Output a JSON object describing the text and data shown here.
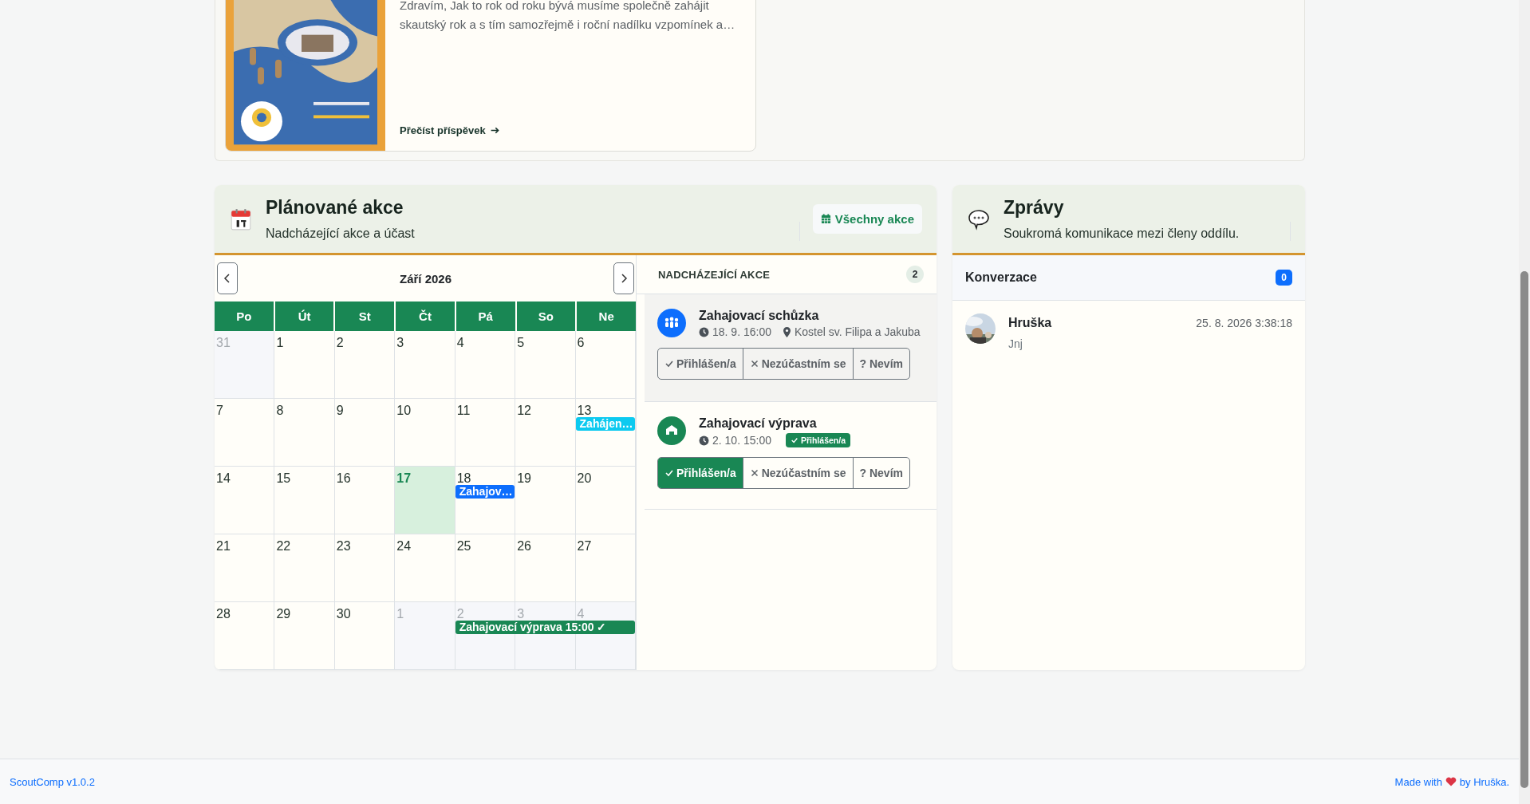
{
  "post": {
    "excerpt": "Zdravím, Jak to rok od roku bývá musíme společně zahájit skautský rok a s tím samozřejmě i roční nadílku vzpomínek a…",
    "link": "Přečíst příspěvek"
  },
  "events_panel": {
    "title": "Plánované akce",
    "subtitle": "Nadcházející akce a účast",
    "all_button": "Všechny akce",
    "calendar": {
      "month": "Září 2026",
      "weekdays": [
        "Po",
        "Út",
        "St",
        "Čt",
        "Pá",
        "So",
        "Ne"
      ],
      "weeks": [
        {
          "days": [
            {
              "label": "31",
              "outside": true,
              "today": false
            },
            {
              "label": "1",
              "outside": false,
              "today": false
            },
            {
              "label": "2",
              "outside": false,
              "today": false
            },
            {
              "label": "3",
              "outside": false,
              "today": false
            },
            {
              "label": "4",
              "outside": false,
              "today": false
            },
            {
              "label": "5",
              "outside": false,
              "today": false
            },
            {
              "label": "6",
              "outside": false,
              "today": false
            }
          ]
        },
        {
          "days": [
            {
              "label": "7",
              "outside": false,
              "today": false
            },
            {
              "label": "8",
              "outside": false,
              "today": false
            },
            {
              "label": "9",
              "outside": false,
              "today": false
            },
            {
              "label": "10",
              "outside": false,
              "today": false
            },
            {
              "label": "11",
              "outside": false,
              "today": false
            },
            {
              "label": "12",
              "outside": false,
              "today": false
            },
            {
              "label": "13",
              "outside": false,
              "today": false,
              "event": {
                "title": "Zahájen…",
                "color": "#0dcaf0"
              }
            }
          ]
        },
        {
          "days": [
            {
              "label": "14",
              "outside": false,
              "today": false
            },
            {
              "label": "15",
              "outside": false,
              "today": false
            },
            {
              "label": "16",
              "outside": false,
              "today": false
            },
            {
              "label": "17",
              "outside": false,
              "today": true
            },
            {
              "label": "18",
              "outside": false,
              "today": false,
              "event": {
                "title": "Zahajov…",
                "color": "#0d6efd"
              }
            },
            {
              "label": "19",
              "outside": false,
              "today": false
            },
            {
              "label": "20",
              "outside": false,
              "today": false
            }
          ]
        },
        {
          "days": [
            {
              "label": "21",
              "outside": false,
              "today": false
            },
            {
              "label": "22",
              "outside": false,
              "today": false
            },
            {
              "label": "23",
              "outside": false,
              "today": false
            },
            {
              "label": "24",
              "outside": false,
              "today": false
            },
            {
              "label": "25",
              "outside": false,
              "today": false
            },
            {
              "label": "26",
              "outside": false,
              "today": false
            },
            {
              "label": "27",
              "outside": false,
              "today": false
            }
          ]
        },
        {
          "days": [
            {
              "label": "28",
              "outside": false,
              "today": false
            },
            {
              "label": "29",
              "outside": false,
              "today": false
            },
            {
              "label": "30",
              "outside": false,
              "today": false
            },
            {
              "label": "1",
              "outside": true,
              "today": false
            },
            {
              "label": "2",
              "outside": true,
              "today": false,
              "event": {
                "title": "Zahajovací výprava 15:00 ✓",
                "color": "#198754"
              }
            },
            {
              "label": "3",
              "outside": true,
              "today": false,
              "event_continues": true
            },
            {
              "label": "4",
              "outside": true,
              "today": false,
              "event_continues": true
            }
          ]
        }
      ]
    },
    "upcoming": {
      "heading": "NADCHÁZEJÍCÍ AKCE",
      "count": "2",
      "items": [
        {
          "title": "Zahajovací schůzka",
          "kind": "group",
          "color": "#0d6efd",
          "highlighted": true,
          "time": "18. 9. 16:00",
          "location": "Kostel sv. Filipa a Jakuba",
          "rsvp": [
            {
              "kind": "check",
              "label": "Přihlášen/a",
              "selected": false
            },
            {
              "kind": "cross",
              "label": "Nezúčastním se",
              "selected": false
            },
            {
              "kind": "plain",
              "label": "? Nevím",
              "selected": false
            }
          ]
        },
        {
          "title": "Zahajovací výprava",
          "kind": "home",
          "color": "#198754",
          "highlighted": false,
          "time": "2. 10. 15:00",
          "status": "Přihlášen/a",
          "rsvp": [
            {
              "kind": "check",
              "label": "Přihlášen/a",
              "selected": true
            },
            {
              "kind": "cross",
              "label": "Nezúčastním se",
              "selected": false
            },
            {
              "kind": "plain",
              "label": "? Nevím",
              "selected": false
            }
          ]
        }
      ]
    }
  },
  "messages": {
    "title": "Zprávy",
    "subtitle": "Soukromá komunikace mezi členy oddílu.",
    "conversations_label": "Konverzace",
    "count": "0",
    "conversations": [
      {
        "name": "Hruška",
        "time": "25. 8. 2026 3:38:18",
        "preview": "Jnj"
      }
    ]
  },
  "footer": {
    "version": "ScoutComp v1.0.2",
    "made_with": "Made with",
    "by": "by Hruška."
  }
}
